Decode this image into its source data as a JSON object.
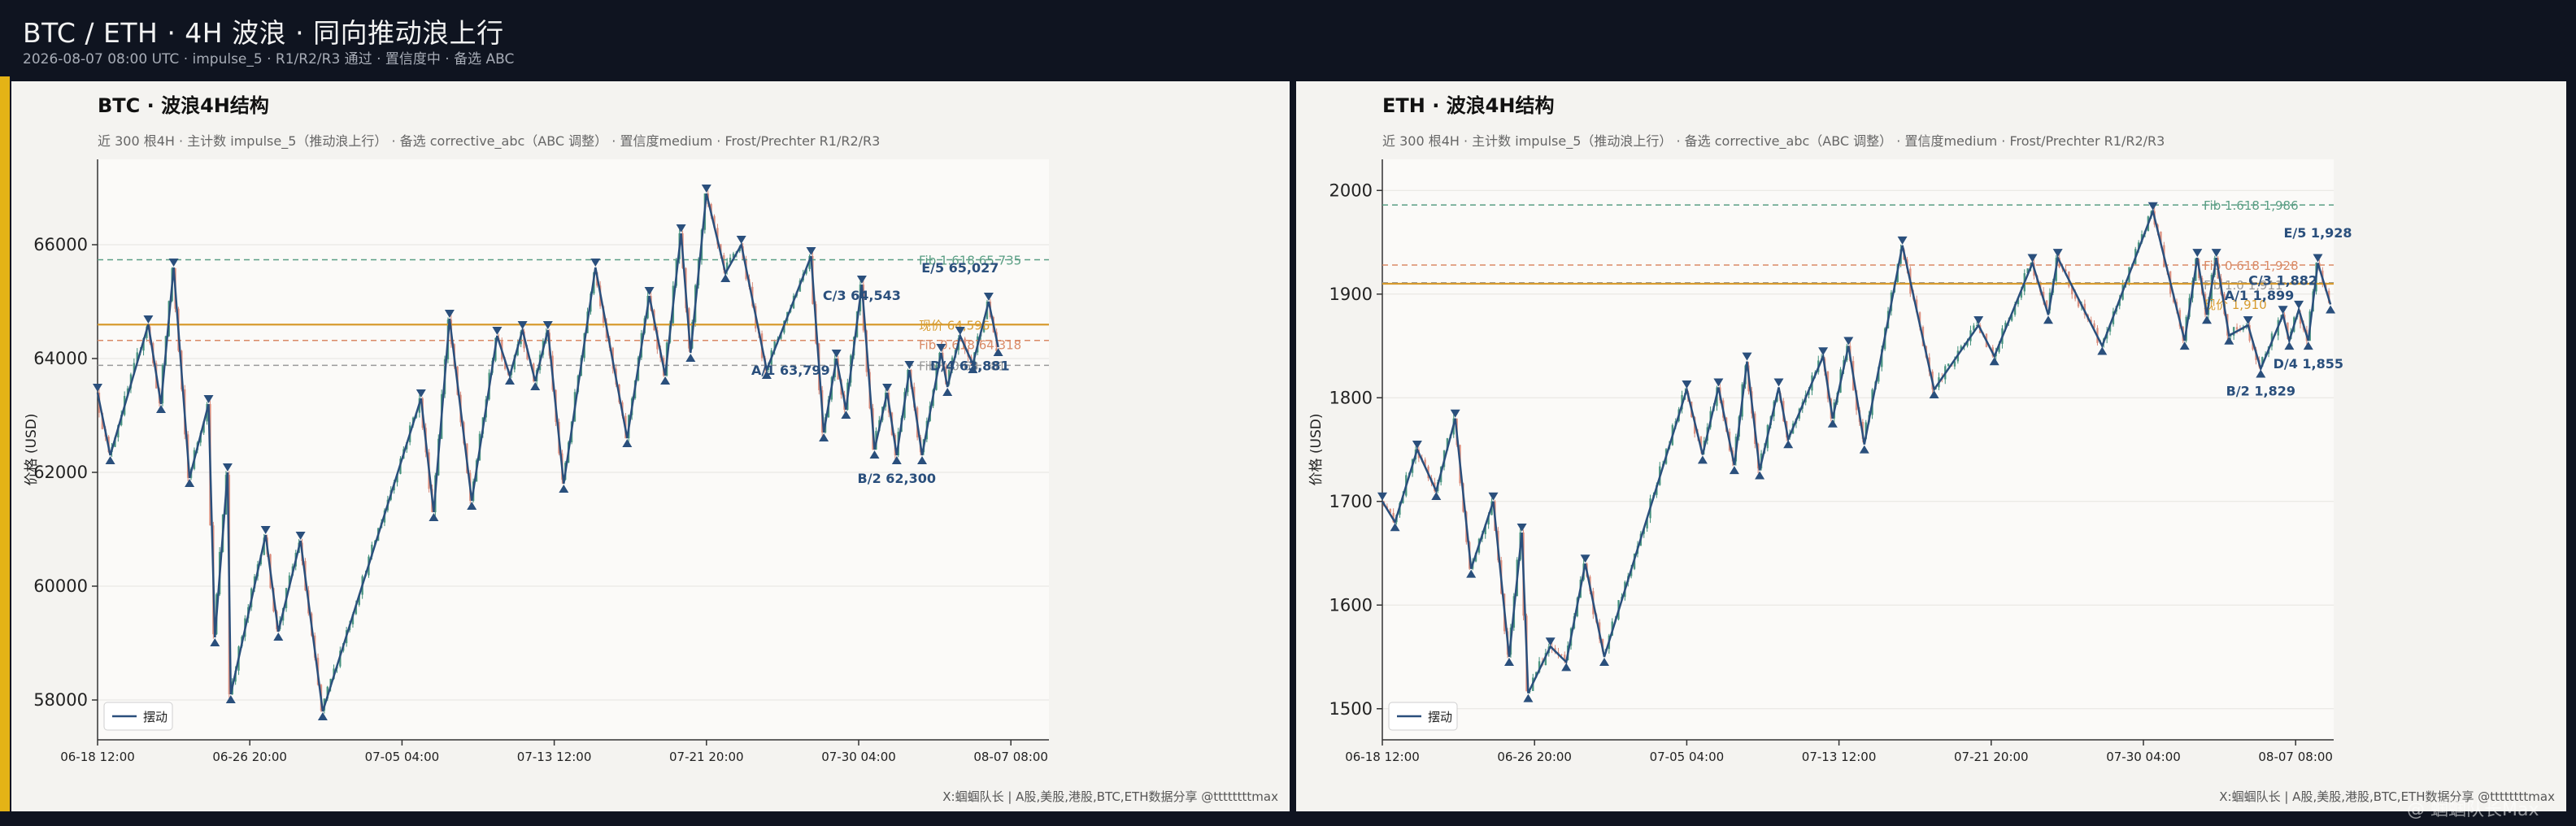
{
  "header": {
    "title": "BTC / ETH ·   4H 波浪 ·   同向推动浪上行",
    "subtitle": "2026-08-07 08:00 UTC ·    impulse_5 ·    R1/R2/R3 通过 ·    置信度中 ·    备选 ABC"
  },
  "watermark": "@ 蝈蝈队长Max",
  "colors": {
    "swing": "#2a4f7c",
    "up": "#3f8f7a",
    "down": "#d98a79",
    "price": "#d79b2f",
    "fib1618": "#5a9e84",
    "fib0618": "#d98a66",
    "fib1": "#9a9a9a"
  },
  "chart_data": [
    {
      "type": "line",
      "title": "BTC  ·  波浪4H结构",
      "subtitle": "近 300 根4H  ·  主计数 impulse_5（推动浪上行）  ·  备选 corrective_abc（ABC 调整）  ·  置信度medium  ·  Frost/Prechter R1/R2/R3",
      "ylabel": "价格 (USD)",
      "ylim": [
        57300,
        67500
      ],
      "yticks": [
        58000,
        60000,
        62000,
        64000,
        66000
      ],
      "ytick_labels": [
        "58000",
        "60000",
        "62000",
        "64000",
        "66000"
      ],
      "xlim": [
        0,
        300
      ],
      "xticks": [
        0,
        48,
        96,
        144,
        192,
        240,
        288
      ],
      "xtick_labels": [
        "06-18 12:00",
        "06-26 20:00",
        "07-05 04:00",
        "07-13 12:00",
        "07-21 20:00",
        "07-30 04:00",
        "08-07 08:00"
      ],
      "legend": {
        "label": "摆动",
        "placement": "bottom-left"
      },
      "levels": [
        {
          "name": "Fib 1.618",
          "value": 65735,
          "label": "Fib 1.618  65,735",
          "color": "#5a9e84",
          "style": "dashed"
        },
        {
          "name": "现价",
          "value": 64596,
          "label": "现价  64,596",
          "color": "#d79b2f",
          "style": "solid"
        },
        {
          "name": "Fib 0.618",
          "value": 64318,
          "label": "Fib 0.618  64,318",
          "color": "#d98a66",
          "style": "dashed"
        },
        {
          "name": "Fib 1.0",
          "value": 63881,
          "label": "Fib 1.0  63,881",
          "color": "#9a9a9a",
          "style": "dashed"
        }
      ],
      "swings": [
        {
          "x": 0,
          "y": 63400,
          "t": "high"
        },
        {
          "x": 4,
          "y": 62300,
          "t": "low"
        },
        {
          "x": 16,
          "y": 64600,
          "t": "high"
        },
        {
          "x": 20,
          "y": 63200,
          "t": "low"
        },
        {
          "x": 24,
          "y": 65600,
          "t": "high"
        },
        {
          "x": 29,
          "y": 61900,
          "t": "low"
        },
        {
          "x": 35,
          "y": 63200,
          "t": "high"
        },
        {
          "x": 37,
          "y": 59100,
          "t": "low"
        },
        {
          "x": 41,
          "y": 62000,
          "t": "high"
        },
        {
          "x": 42,
          "y": 58100,
          "t": "low"
        },
        {
          "x": 53,
          "y": 60900,
          "t": "high"
        },
        {
          "x": 57,
          "y": 59200,
          "t": "low"
        },
        {
          "x": 64,
          "y": 60800,
          "t": "high"
        },
        {
          "x": 71,
          "y": 57800,
          "t": "low"
        },
        {
          "x": 102,
          "y": 63300,
          "t": "high"
        },
        {
          "x": 106,
          "y": 61300,
          "t": "low"
        },
        {
          "x": 111,
          "y": 64700,
          "t": "high"
        },
        {
          "x": 118,
          "y": 61500,
          "t": "low"
        },
        {
          "x": 126,
          "y": 64400,
          "t": "high"
        },
        {
          "x": 130,
          "y": 63700,
          "t": "low"
        },
        {
          "x": 134,
          "y": 64500,
          "t": "high"
        },
        {
          "x": 138,
          "y": 63600,
          "t": "low"
        },
        {
          "x": 142,
          "y": 64500,
          "t": "high"
        },
        {
          "x": 147,
          "y": 61800,
          "t": "low"
        },
        {
          "x": 157,
          "y": 65600,
          "t": "high"
        },
        {
          "x": 167,
          "y": 62600,
          "t": "low"
        },
        {
          "x": 174,
          "y": 65100,
          "t": "high"
        },
        {
          "x": 179,
          "y": 63700,
          "t": "low"
        },
        {
          "x": 184,
          "y": 66200,
          "t": "high"
        },
        {
          "x": 187,
          "y": 64100,
          "t": "low"
        },
        {
          "x": 192,
          "y": 66900,
          "t": "high"
        },
        {
          "x": 198,
          "y": 65500,
          "t": "low"
        },
        {
          "x": 203,
          "y": 66000,
          "t": "high"
        },
        {
          "x": 211,
          "y": 63800,
          "t": "low"
        },
        {
          "x": 225,
          "y": 65800,
          "t": "high"
        },
        {
          "x": 229,
          "y": 62700,
          "t": "low"
        },
        {
          "x": 233,
          "y": 64000,
          "t": "high"
        },
        {
          "x": 236,
          "y": 63100,
          "t": "low"
        },
        {
          "x": 241,
          "y": 65300,
          "t": "high"
        },
        {
          "x": 245,
          "y": 62400,
          "t": "low"
        },
        {
          "x": 249,
          "y": 63400,
          "t": "high"
        },
        {
          "x": 252,
          "y": 62300,
          "t": "low"
        },
        {
          "x": 256,
          "y": 63800,
          "t": "high"
        },
        {
          "x": 260,
          "y": 62300,
          "t": "low"
        },
        {
          "x": 266,
          "y": 64100,
          "t": "high"
        },
        {
          "x": 268,
          "y": 63500,
          "t": "low"
        },
        {
          "x": 272,
          "y": 64400,
          "t": "high"
        },
        {
          "x": 276,
          "y": 63900,
          "t": "low"
        },
        {
          "x": 281,
          "y": 65000,
          "t": "high"
        },
        {
          "x": 284,
          "y": 64200,
          "t": "low"
        }
      ],
      "waves": [
        {
          "label": "A/1",
          "value": "63,799",
          "x": 233,
          "y": 63799,
          "pos": "left"
        },
        {
          "label": "B/2",
          "value": "62,300",
          "x": 252,
          "y": 62300,
          "pos": "below"
        },
        {
          "label": "C/3",
          "value": "64,543",
          "x": 241,
          "y": 64543,
          "pos": "above"
        },
        {
          "label": "D/4",
          "value": "63,881",
          "x": 260,
          "y": 63881,
          "pos": "right"
        },
        {
          "label": "E/5",
          "value": "65,027",
          "x": 272,
          "y": 65027,
          "pos": "above"
        }
      ]
    },
    {
      "type": "line",
      "title": "ETH  ·  波浪4H结构",
      "subtitle": "近 300 根4H  ·  主计数 impulse_5（推动浪上行）  ·  备选 corrective_abc（ABC 调整）  ·  置信度medium  ·  Frost/Prechter R1/R2/R3",
      "ylabel": "价格 (USD)",
      "ylim": [
        1470,
        2030
      ],
      "yticks": [
        1500,
        1600,
        1700,
        1800,
        1900,
        2000
      ],
      "ytick_labels": [
        "1500",
        "1600",
        "1700",
        "1800",
        "1900",
        "2000"
      ],
      "xlim": [
        0,
        300
      ],
      "xticks": [
        0,
        48,
        96,
        144,
        192,
        240,
        288
      ],
      "xtick_labels": [
        "06-18 12:00",
        "06-26 20:00",
        "07-05 04:00",
        "07-13 12:00",
        "07-21 20:00",
        "07-30 04:00",
        "08-07 08:00"
      ],
      "legend": {
        "label": "摆动",
        "placement": "bottom-left"
      },
      "levels": [
        {
          "name": "Fib 1.618",
          "value": 1986,
          "label": "Fib 1.618  1,986",
          "color": "#5a9e84",
          "style": "dashed"
        },
        {
          "name": "Fib 0.618",
          "value": 1928,
          "label": "Fib 0.618  1,928",
          "color": "#d98a66",
          "style": "dashed"
        },
        {
          "name": "Fib 1.0",
          "value": 1911,
          "label": "Fib 1.0  1,911",
          "color": "#9a9a9a",
          "style": "dashed"
        },
        {
          "name": "现价",
          "value": 1910,
          "label": "现价  1,910",
          "color": "#d79b2f",
          "style": "solid"
        }
      ],
      "swings": [
        {
          "x": 0,
          "y": 1700,
          "t": "high"
        },
        {
          "x": 4,
          "y": 1680,
          "t": "low"
        },
        {
          "x": 11,
          "y": 1750,
          "t": "high"
        },
        {
          "x": 17,
          "y": 1710,
          "t": "low"
        },
        {
          "x": 23,
          "y": 1780,
          "t": "high"
        },
        {
          "x": 28,
          "y": 1635,
          "t": "low"
        },
        {
          "x": 35,
          "y": 1700,
          "t": "high"
        },
        {
          "x": 40,
          "y": 1550,
          "t": "low"
        },
        {
          "x": 44,
          "y": 1670,
          "t": "high"
        },
        {
          "x": 46,
          "y": 1515,
          "t": "low"
        },
        {
          "x": 53,
          "y": 1560,
          "t": "high"
        },
        {
          "x": 58,
          "y": 1545,
          "t": "low"
        },
        {
          "x": 64,
          "y": 1640,
          "t": "high"
        },
        {
          "x": 70,
          "y": 1550,
          "t": "low"
        },
        {
          "x": 96,
          "y": 1808,
          "t": "high"
        },
        {
          "x": 101,
          "y": 1745,
          "t": "low"
        },
        {
          "x": 106,
          "y": 1810,
          "t": "high"
        },
        {
          "x": 111,
          "y": 1735,
          "t": "low"
        },
        {
          "x": 115,
          "y": 1835,
          "t": "high"
        },
        {
          "x": 119,
          "y": 1730,
          "t": "low"
        },
        {
          "x": 125,
          "y": 1810,
          "t": "high"
        },
        {
          "x": 128,
          "y": 1760,
          "t": "low"
        },
        {
          "x": 139,
          "y": 1840,
          "t": "high"
        },
        {
          "x": 142,
          "y": 1780,
          "t": "low"
        },
        {
          "x": 147,
          "y": 1850,
          "t": "high"
        },
        {
          "x": 152,
          "y": 1755,
          "t": "low"
        },
        {
          "x": 164,
          "y": 1947,
          "t": "high"
        },
        {
          "x": 174,
          "y": 1808,
          "t": "low"
        },
        {
          "x": 188,
          "y": 1870,
          "t": "high"
        },
        {
          "x": 193,
          "y": 1840,
          "t": "low"
        },
        {
          "x": 205,
          "y": 1930,
          "t": "high"
        },
        {
          "x": 210,
          "y": 1880,
          "t": "low"
        },
        {
          "x": 213,
          "y": 1935,
          "t": "high"
        },
        {
          "x": 227,
          "y": 1850,
          "t": "low"
        },
        {
          "x": 243,
          "y": 1980,
          "t": "high"
        },
        {
          "x": 253,
          "y": 1855,
          "t": "low"
        },
        {
          "x": 257,
          "y": 1935,
          "t": "high"
        },
        {
          "x": 260,
          "y": 1880,
          "t": "low"
        },
        {
          "x": 263,
          "y": 1935,
          "t": "high"
        },
        {
          "x": 267,
          "y": 1860,
          "t": "low"
        },
        {
          "x": 273,
          "y": 1870,
          "t": "high"
        },
        {
          "x": 277,
          "y": 1828,
          "t": "low"
        },
        {
          "x": 284,
          "y": 1880,
          "t": "high"
        },
        {
          "x": 286,
          "y": 1855,
          "t": "low"
        },
        {
          "x": 289,
          "y": 1885,
          "t": "high"
        },
        {
          "x": 292,
          "y": 1855,
          "t": "low"
        },
        {
          "x": 295,
          "y": 1930,
          "t": "high"
        },
        {
          "x": 299,
          "y": 1890,
          "t": "low"
        }
      ],
      "waves": [
        {
          "label": "A/1",
          "value": "1,899",
          "x": 263,
          "y": 1899,
          "pos": "right"
        },
        {
          "label": "B/2",
          "value": "1,829",
          "x": 277,
          "y": 1829,
          "pos": "below"
        },
        {
          "label": "C/3",
          "value": "1,882",
          "x": 284,
          "y": 1882,
          "pos": "above"
        },
        {
          "label": "D/4",
          "value": "1,855",
          "x": 292,
          "y": 1855,
          "pos": "below"
        },
        {
          "label": "E/5",
          "value": "1,928",
          "x": 295,
          "y": 1928,
          "pos": "above"
        }
      ]
    }
  ],
  "footer": "X:蝈蝈队长 | A股,美股,港股,BTC,ETH数据分享 @ttttttttmax"
}
